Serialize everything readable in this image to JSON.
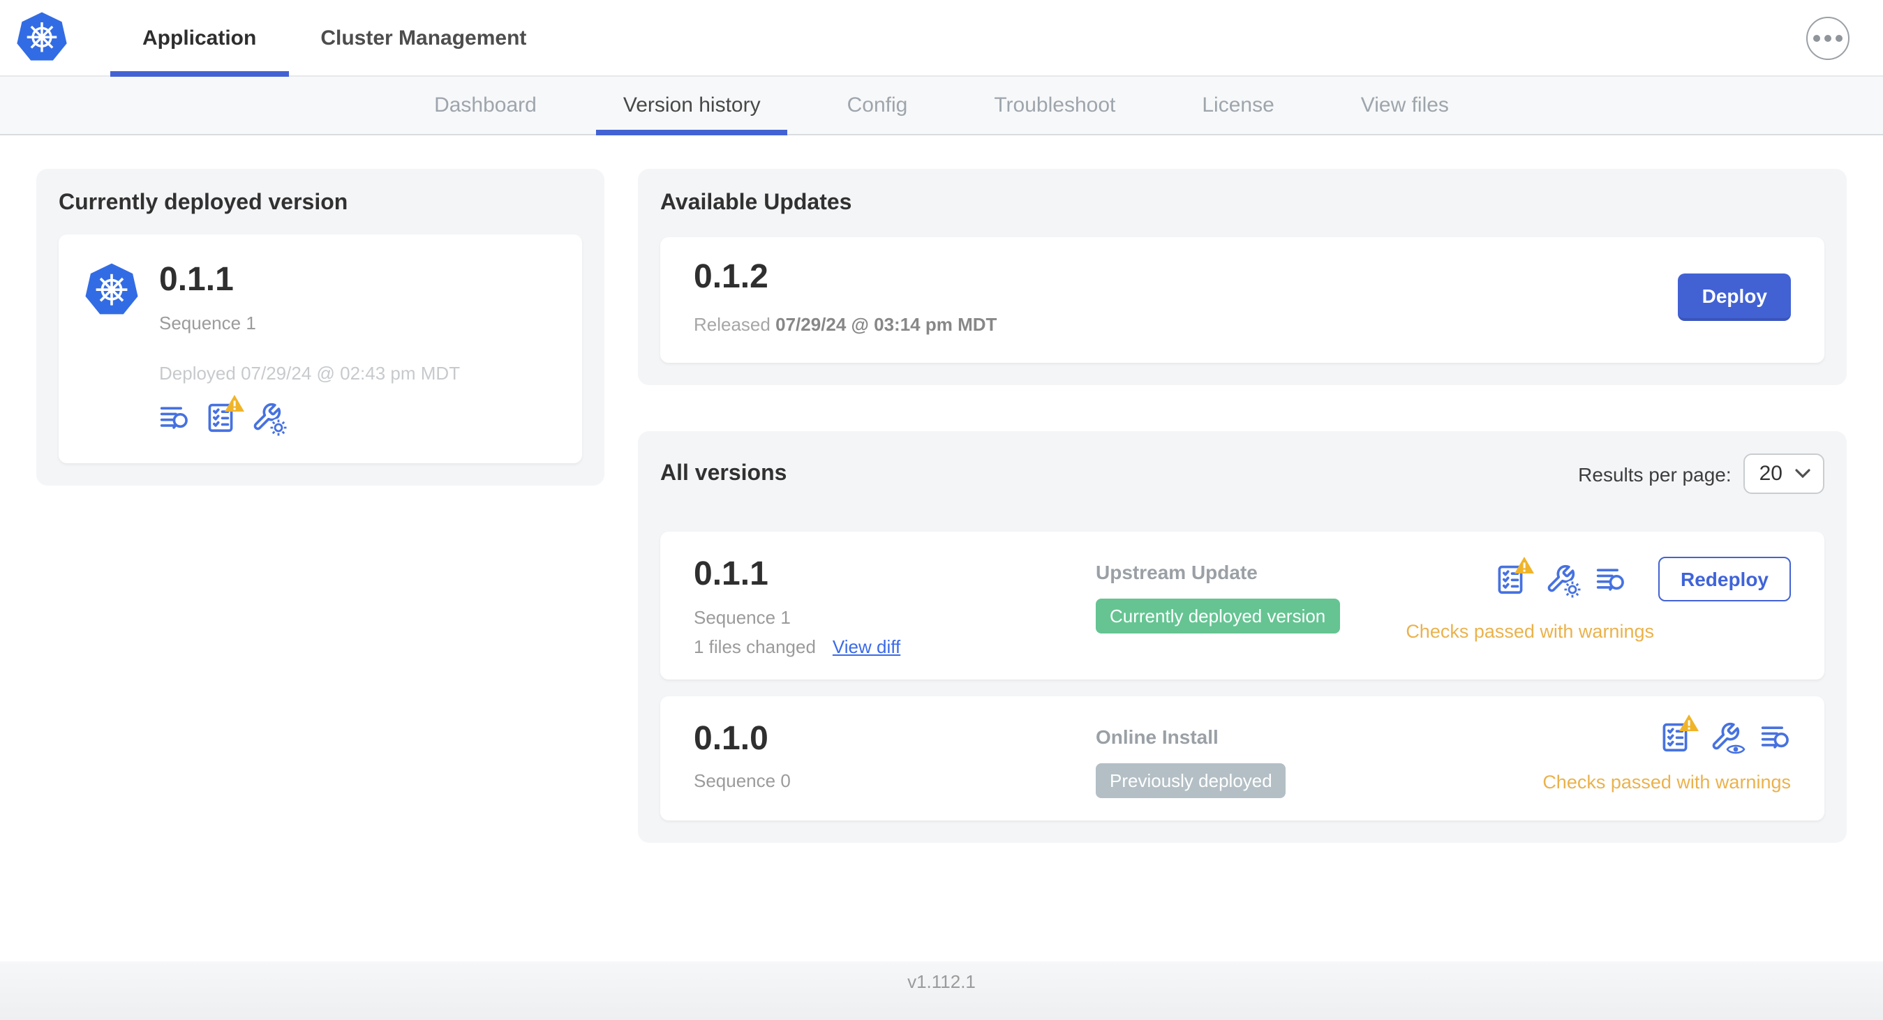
{
  "header": {
    "tabs": [
      {
        "label": "Application",
        "active": true
      },
      {
        "label": "Cluster Management",
        "active": false
      }
    ],
    "menu_icon": "ellipsis-in-circle-icon"
  },
  "subnav": {
    "tabs": [
      {
        "label": "Dashboard",
        "active": false
      },
      {
        "label": "Version history",
        "active": true
      },
      {
        "label": "Config",
        "active": false
      },
      {
        "label": "Troubleshoot",
        "active": false
      },
      {
        "label": "License",
        "active": false
      },
      {
        "label": "View files",
        "active": false
      }
    ]
  },
  "current_version": {
    "title": "Currently deployed version",
    "version": "0.1.1",
    "sequence": "Sequence 1",
    "deployed": "Deployed 07/29/24 @ 02:43 pm MDT",
    "icons": [
      "diff-logs-icon",
      "preflight-checks-warning-icon",
      "config-wrench-gear-icon"
    ]
  },
  "available_updates": {
    "title": "Available Updates",
    "version": "0.1.2",
    "released_label": "Released",
    "released_date": "07/29/24 @ 03:14 pm MDT",
    "deploy_label": "Deploy"
  },
  "all_versions": {
    "title": "All versions",
    "results_per_page_label": "Results per page:",
    "results_per_page_value": "20",
    "rows": [
      {
        "version": "0.1.1",
        "sequence": "Sequence 1",
        "files_changed": "1 files changed",
        "view_diff_label": "View diff",
        "source": "Upstream Update",
        "badge": "Currently deployed version",
        "badge_color": "#65c492",
        "icons": [
          "preflight-checks-warning-icon",
          "config-wrench-gear-icon",
          "diff-logs-icon"
        ],
        "action_label": "Redeploy",
        "status": "Checks passed with warnings"
      },
      {
        "version": "0.1.0",
        "sequence": "Sequence 0",
        "source": "Online Install",
        "badge": "Previously deployed",
        "badge_color": "#b3bfc5",
        "icons": [
          "preflight-checks-warning-icon",
          "view-config-wrench-eye-icon",
          "diff-logs-icon"
        ],
        "status": "Checks passed with warnings"
      }
    ]
  },
  "footer": {
    "version": "v1.112.1"
  },
  "colors": {
    "primary_blue": "#4262d4",
    "link_blue": "#3b6ae8",
    "icon_blue": "#4671e0",
    "kubernetes_blue": "#326ce5",
    "warning_amber": "#eab24c",
    "warning_triangle": "#f0b429",
    "badge_green": "#65c492",
    "badge_gray": "#b3bfc5"
  }
}
